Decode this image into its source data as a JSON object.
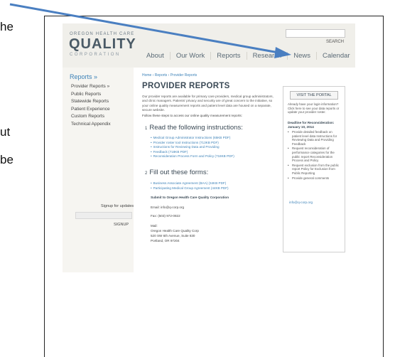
{
  "document": {
    "fragments": [
      "he",
      "ut",
      "be"
    ]
  },
  "webpage": {
    "header": {
      "logo_top": "OREGON HEALTH CARE",
      "logo_main": "QUALITY",
      "logo_sub": "CORPORATION",
      "search_label": "SEARCH",
      "nav": [
        "About",
        "Our Work",
        "Reports",
        "Research",
        "News",
        "Calendar"
      ]
    },
    "leftnav": {
      "title": "Reports »",
      "items": [
        "Provider Reports »",
        "Public Reports",
        "Statewide Reports",
        "Patient Experience",
        "Custom Reports",
        "Technical Appendix"
      ],
      "signup_label": "Signup for updates",
      "signup_button": "SIGNUP"
    },
    "main": {
      "breadcrumb": "Home › Reports › Provider Reports",
      "title": "PROVIDER REPORTS",
      "intro": "Our provider reports are available for primary care providers, medical group administrators, and clinic managers. Patients' privacy and security are of great concern to the initiative, so your online quality measurement reports and patient level data are housed on a separate, secure website.",
      "follow": "Follow these steps to access our online quality measurement reports:",
      "step1_num": "1",
      "step1_title": "Read the following instructions:",
      "step1_links": [
        "Medical Group Administrator Instructions (65KB PDF)",
        "Provider roster tool Instructions (713KB PDF)",
        "Instructions for Reviewing Data and Providing",
        "Feedback (718KB PDF)",
        "Reconsideration Process Form and Policy (718KB PDF)"
      ],
      "step2_num": "2",
      "step2_title": "Fill out these forms:",
      "step2_links": [
        "Business Associate Agreement (BAA) (34KB PDF)",
        "Participating Medical Group Agreement (44KB PDF)"
      ],
      "submit_heading": "Submit to Oregon Health Care Quality Corporation",
      "email_line": "Email: info@q-corp.org",
      "fax_line": "Fax: (503) 972-0822",
      "mail_label": "Mail:",
      "address": [
        "Oregon Health Care Quality Corp",
        "520 SW 6th Avenue, Suite 830",
        "Portland, OR 97204"
      ]
    },
    "sidebar": {
      "portal_button": "VISIT THE PORTAL",
      "note": "Already have your login information? Click here to see your data reports or update your provider roster.",
      "deadline": "Deadline for Reconsideration: January 10, 2014",
      "items": [
        "Provide detailed feedback on patient level data Instructions for Reviewing Data and Providing Feedback",
        "Request reconsideration of performance categories for the public report Reconsideration Process and Policy",
        "Request exclusion from the public report Policy for Exclusion from Public Reporting",
        "Provide general comments"
      ],
      "email": "info@q-corp.org"
    }
  },
  "colors": {
    "arrow": "#4a7fc1",
    "link": "#3d82b8",
    "heading": "#3b4a56"
  }
}
